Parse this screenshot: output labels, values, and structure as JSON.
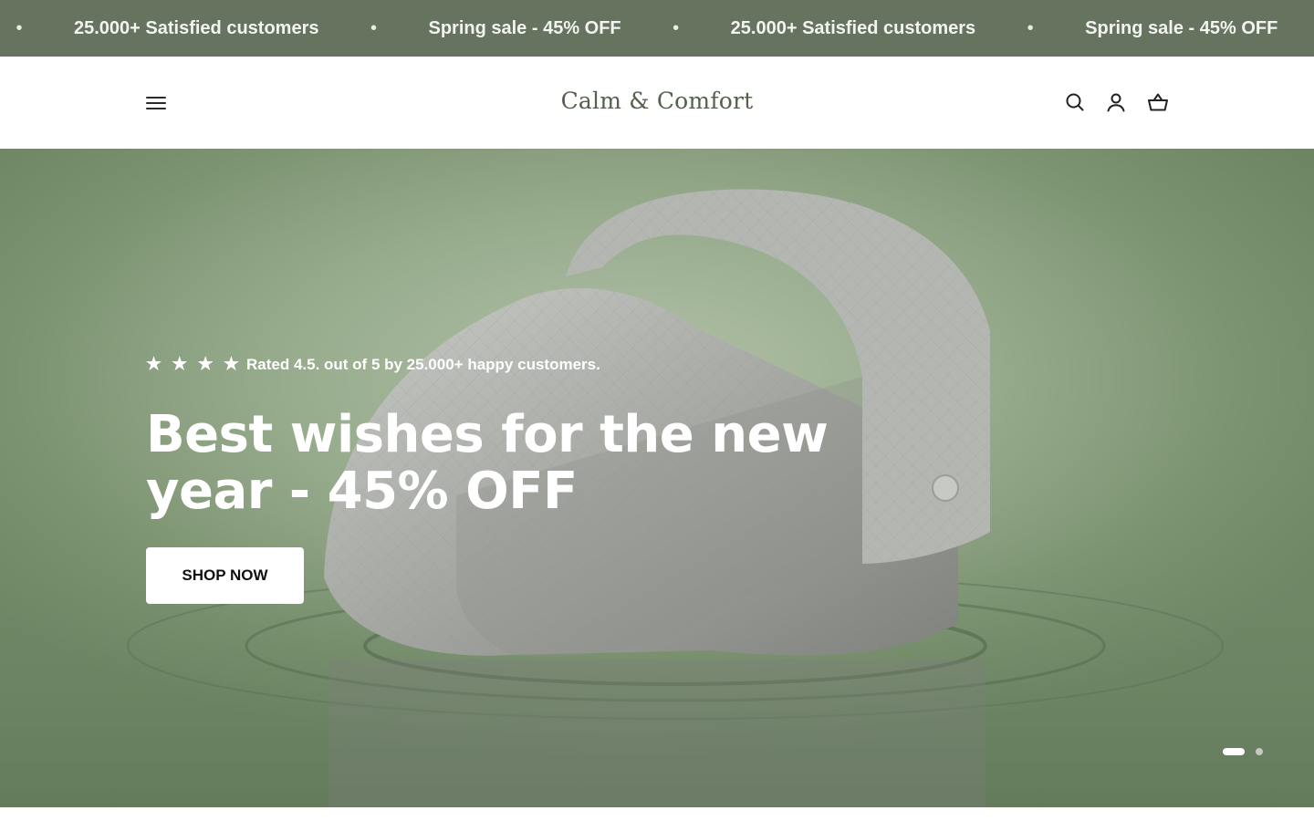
{
  "announcement": {
    "items": [
      "25.000+ Satisfied customers",
      "Spring sale - 45% OFF",
      "25.000+ Satisfied customers",
      "Spring sale - 45% OFF"
    ],
    "separator": "•"
  },
  "header": {
    "logo": "Calm & Comfort",
    "icons": [
      "menu-icon",
      "search-icon",
      "account-icon",
      "cart-icon"
    ]
  },
  "hero": {
    "stars": "★ ★ ★ ★",
    "rating_text": "Rated 4.5. out of 5 by 25.000+ happy customers.",
    "title": "Best wishes for the new year - 45% OFF",
    "button_label": "SHOP NOW",
    "slides": {
      "current": 1,
      "total": 2
    }
  },
  "colors": {
    "announcement_bg": "#66735e",
    "logo": "#55604f",
    "hero_bg": "#95aa8b",
    "button_bg": "#ffffff"
  }
}
